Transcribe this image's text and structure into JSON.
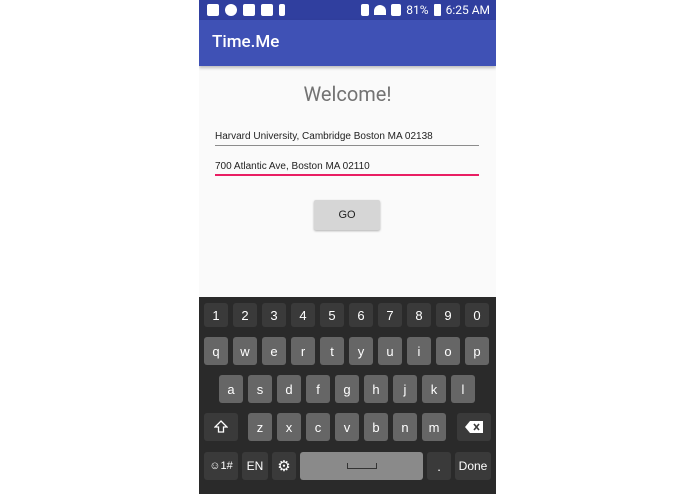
{
  "status_bar": {
    "battery": "81%",
    "time": "6:25 AM"
  },
  "app_bar": {
    "title": "Time.Me"
  },
  "main": {
    "welcome": "Welcome!",
    "origin_value": "Harvard University, Cambridge Boston MA 02138",
    "destination_value": "700 Atlantic Ave, Boston MA 02110",
    "go_label": "GO"
  },
  "keyboard": {
    "numbers": [
      "1",
      "2",
      "3",
      "4",
      "5",
      "6",
      "7",
      "8",
      "9",
      "0"
    ],
    "row1": [
      "q",
      "w",
      "e",
      "r",
      "t",
      "y",
      "u",
      "i",
      "o",
      "p"
    ],
    "row2": [
      "a",
      "s",
      "d",
      "f",
      "g",
      "h",
      "j",
      "k",
      "l"
    ],
    "row3": [
      "z",
      "x",
      "c",
      "v",
      "b",
      "n",
      "m"
    ],
    "symbols_label": "☺1#",
    "lang_label": "EN",
    "period_label": ".",
    "done_label": "Done"
  }
}
